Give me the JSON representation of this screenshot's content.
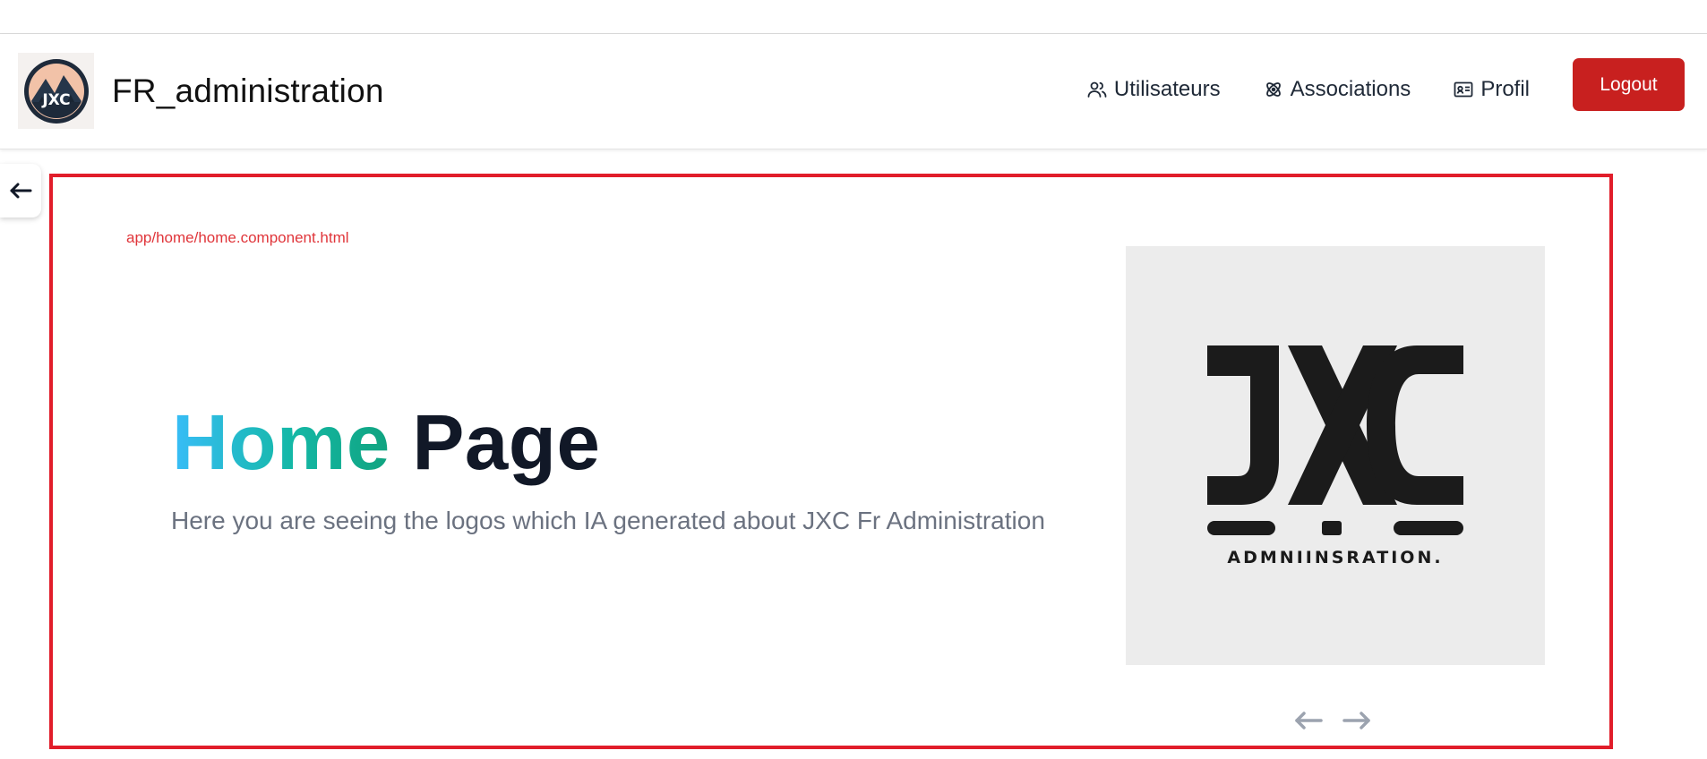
{
  "header": {
    "brand_title": "FR_administration",
    "logo_text": "JXC",
    "nav": [
      {
        "label": "Utilisateurs",
        "icon": "users-icon"
      },
      {
        "label": "Associations",
        "icon": "associations-icon"
      },
      {
        "label": "Profil",
        "icon": "id-card-icon"
      }
    ],
    "logout_label": "Logout"
  },
  "main": {
    "component_path": "app/home/home.component.html",
    "title_word1": "Home",
    "title_word2": "Page",
    "subtitle": "Here you are seeing the logos which IA generated about JXC Fr Administration",
    "carousel_image_caption": "ADMNIINSRATION."
  },
  "colors": {
    "accent_red": "#c8201f",
    "frame_red": "#e11d2a",
    "gradient_start": "#38bdf8",
    "gradient_end": "#10a37f"
  }
}
